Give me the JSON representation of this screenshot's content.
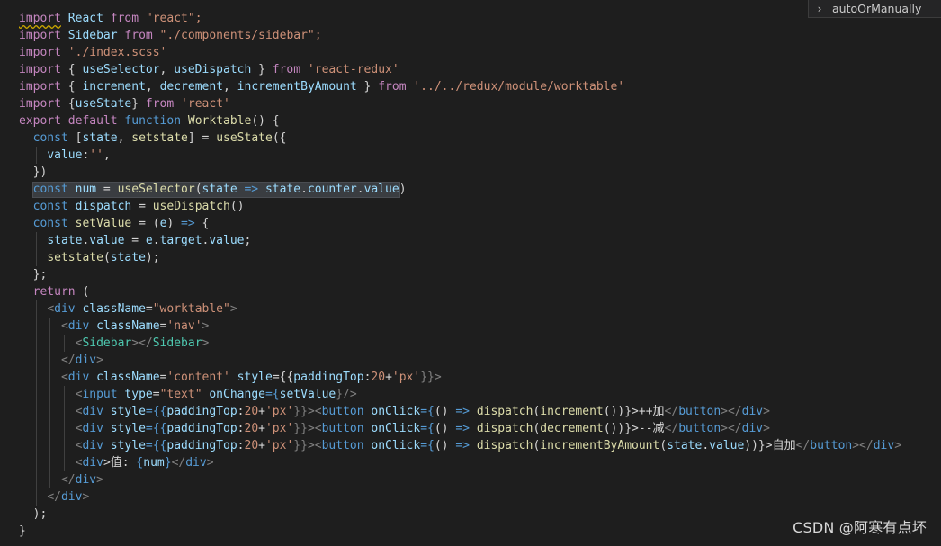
{
  "outline_popup": {
    "label": "autoOrManually"
  },
  "watermark": "CSDN @阿寒有点坏",
  "code": {
    "l1": [
      "import",
      " React ",
      "from",
      " \"react\";"
    ],
    "l2": [
      "import",
      " Sidebar ",
      "from",
      " \"./components/sidebar\";"
    ],
    "l3": [
      "import",
      " ",
      "'./index.scss'"
    ],
    "l4": [
      "import",
      " { ",
      "useSelector",
      ", ",
      "useDispatch",
      " } ",
      "from",
      " ",
      "'react-redux'"
    ],
    "l5": [
      "import",
      " { ",
      "increment",
      ", ",
      "decrement",
      ", ",
      "incrementByAmount",
      " } ",
      "from",
      " ",
      "'../../redux/module/worktable'"
    ],
    "l6": [
      "import",
      " {",
      "useState",
      "} ",
      "from",
      " ",
      "'react'"
    ],
    "l7": [
      "export",
      " ",
      "default",
      " ",
      "function",
      " ",
      "Worktable",
      "() {"
    ],
    "l8": [
      "const",
      " [",
      "state",
      ", ",
      "setstate",
      "] = ",
      "useState",
      "({"
    ],
    "l9": [
      "value",
      ":",
      "''",
      ","
    ],
    "l10": [
      "})"
    ],
    "l11": [
      "const",
      " ",
      "num",
      " = ",
      "useSelector",
      "(",
      "state",
      " => ",
      "state",
      ".",
      "counter",
      ".",
      "value",
      ")"
    ],
    "l12": [
      "const",
      " ",
      "dispatch",
      " = ",
      "useDispatch",
      "()"
    ],
    "l13": [
      "const",
      " ",
      "setValue",
      " = (",
      "e",
      ") ",
      "=>",
      " {"
    ],
    "l14": [
      "state",
      ".",
      "value",
      " = ",
      "e",
      ".",
      "target",
      ".",
      "value",
      ";"
    ],
    "l15": [
      "setstate",
      "(",
      "state",
      ");"
    ],
    "l16": [
      "};"
    ],
    "l17": [
      "return",
      " ("
    ],
    "l18": [
      "<",
      "div",
      " ",
      "className",
      "=",
      "\"worktable\"",
      ">"
    ],
    "l19": [
      "<",
      "div",
      " ",
      "className",
      "=",
      "'nav'",
      ">"
    ],
    "l20": [
      "<",
      "Sidebar",
      "></",
      "Sidebar",
      ">"
    ],
    "l21": [
      "</",
      "div",
      ">"
    ],
    "l22": [
      "<",
      "div",
      " ",
      "className",
      "=",
      "'content'",
      " ",
      "style",
      "={{",
      "paddingTop",
      ":",
      "20",
      "+",
      "'px'",
      "}}>"
    ],
    "l23": [
      "<",
      "input",
      " ",
      "type",
      "=",
      "\"text\"",
      " ",
      "onChange",
      "={",
      "setValue",
      "}/>"
    ],
    "l24": [
      "<",
      "div",
      " ",
      "style",
      "={{",
      "paddingTop",
      ":",
      "20",
      "+",
      "'px'",
      "}}><",
      "button",
      " ",
      "onClick",
      "={",
      "() ",
      "=>",
      " ",
      "dispatch",
      "(",
      "increment",
      "())}>",
      "++加",
      "</",
      "button",
      "></",
      "div",
      ">"
    ],
    "l25": [
      "<",
      "div",
      " ",
      "style",
      "={{",
      "paddingTop",
      ":",
      "20",
      "+",
      "'px'",
      "}}><",
      "button",
      " ",
      "onClick",
      "={",
      "() ",
      "=>",
      " ",
      "dispatch",
      "(",
      "decrement",
      "())}>",
      "--减",
      "</",
      "button",
      "></",
      "div",
      ">"
    ],
    "l26": [
      "<",
      "div",
      " ",
      "style",
      "={{",
      "paddingTop",
      ":",
      "20",
      "+",
      "'px'",
      "}}><",
      "button",
      " ",
      "onClick",
      "={",
      "() ",
      "=>",
      " ",
      "dispatch",
      "(",
      "incrementByAmount",
      "(",
      "state",
      ".",
      "value",
      "))}>",
      "自加",
      "</",
      "button",
      "></",
      "div",
      ">"
    ],
    "l27": [
      "<",
      "div",
      ">值: ",
      "{",
      "num",
      "}",
      "</",
      "div",
      ">"
    ],
    "l28": [
      "</",
      "div",
      ">"
    ],
    "l29": [
      "</",
      "div",
      ">"
    ],
    "l30": [
      ");"
    ],
    "l31": [
      "}"
    ]
  }
}
